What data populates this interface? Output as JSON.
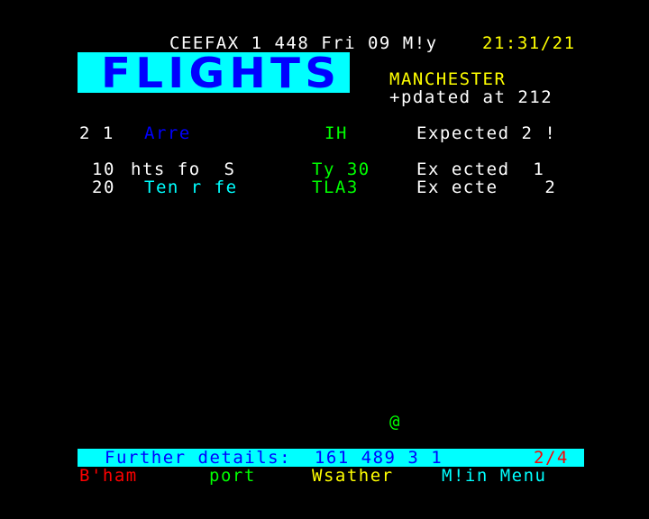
{
  "header": {
    "service_line": "CEEFAX 1 448 Fri 09 M!y",
    "clock": "21:31/21"
  },
  "title": {
    "graphic_text": "FLIGHTS"
  },
  "airport": "MANCHESTER",
  "updated": "+pdated at 212",
  "columns": {
    "date": "2 1",
    "destination": "Arre",
    "code": "IH",
    "status": "Expected 2 !"
  },
  "rows": [
    {
      "num": "10",
      "destination": "hts fo  S",
      "flight": "Ty 30",
      "status": "Ex ected  1"
    },
    {
      "num": "20",
      "destination": "Ten r fe",
      "flight": "TLA3",
      "status": "Ex ecte    2"
    }
  ],
  "misc_char": "@",
  "footer": {
    "label": "Further details:  161 489 3 1",
    "page": "2/4"
  },
  "fastext": {
    "red": "B'ham",
    "green": "port",
    "yellow": "Wsather",
    "cyan": "M!in Menu"
  },
  "colors": {
    "background": "#000000",
    "banner": "#00ffff",
    "title": "#0000ff"
  }
}
